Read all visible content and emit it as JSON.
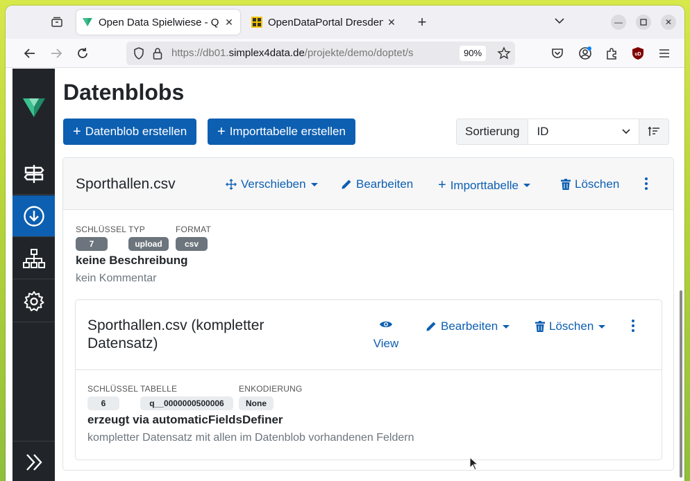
{
  "browser": {
    "tabs": [
      {
        "title": "Open Data Spielwiese - Q",
        "active": true
      },
      {
        "title": "OpenDataPortal Dresden",
        "active": false
      }
    ],
    "url_prefix": "https://db01.",
    "url_host": "simplex4data.de",
    "url_path": "/projekte/demo/doptet/s",
    "zoom": "90%"
  },
  "page": {
    "title": "Datenblobs",
    "create_blob_label": "Datenblob erstellen",
    "create_import_label": "Importtabelle erstellen",
    "sort_label": "Sortierung",
    "sort_value": "ID"
  },
  "blob": {
    "name": "Sporthallen.csv",
    "actions": {
      "move": "Verschieben",
      "edit": "Bearbeiten",
      "importtable": "Importtabelle",
      "delete": "Löschen"
    },
    "meta": {
      "key_label": "SCHLÜSSEL",
      "key_value": "7",
      "type_label": "TYP",
      "type_value": "upload",
      "format_label": "FORMAT",
      "format_value": "csv"
    },
    "description": "keine Beschreibung",
    "comment": "kein Kommentar"
  },
  "import_table": {
    "name": "Sporthallen.csv (kompletter Datensatz)",
    "actions": {
      "view": "View",
      "edit": "Bearbeiten",
      "delete": "Löschen"
    },
    "meta": {
      "key_label": "SCHLÜSSEL",
      "key_value": "6",
      "table_label": "TABELLE",
      "table_value": "q__0000000500006",
      "encoding_label": "ENKODIERUNG",
      "encoding_value": "None"
    },
    "description": "erzeugt via automaticFieldsDefiner",
    "comment": "kompletter Datensatz mit allen im Datenblob vorhandenen Feldern"
  },
  "colors": {
    "primary": "#0d5fb1",
    "sidebar": "#212529",
    "badge_dark": "#6c757d"
  }
}
